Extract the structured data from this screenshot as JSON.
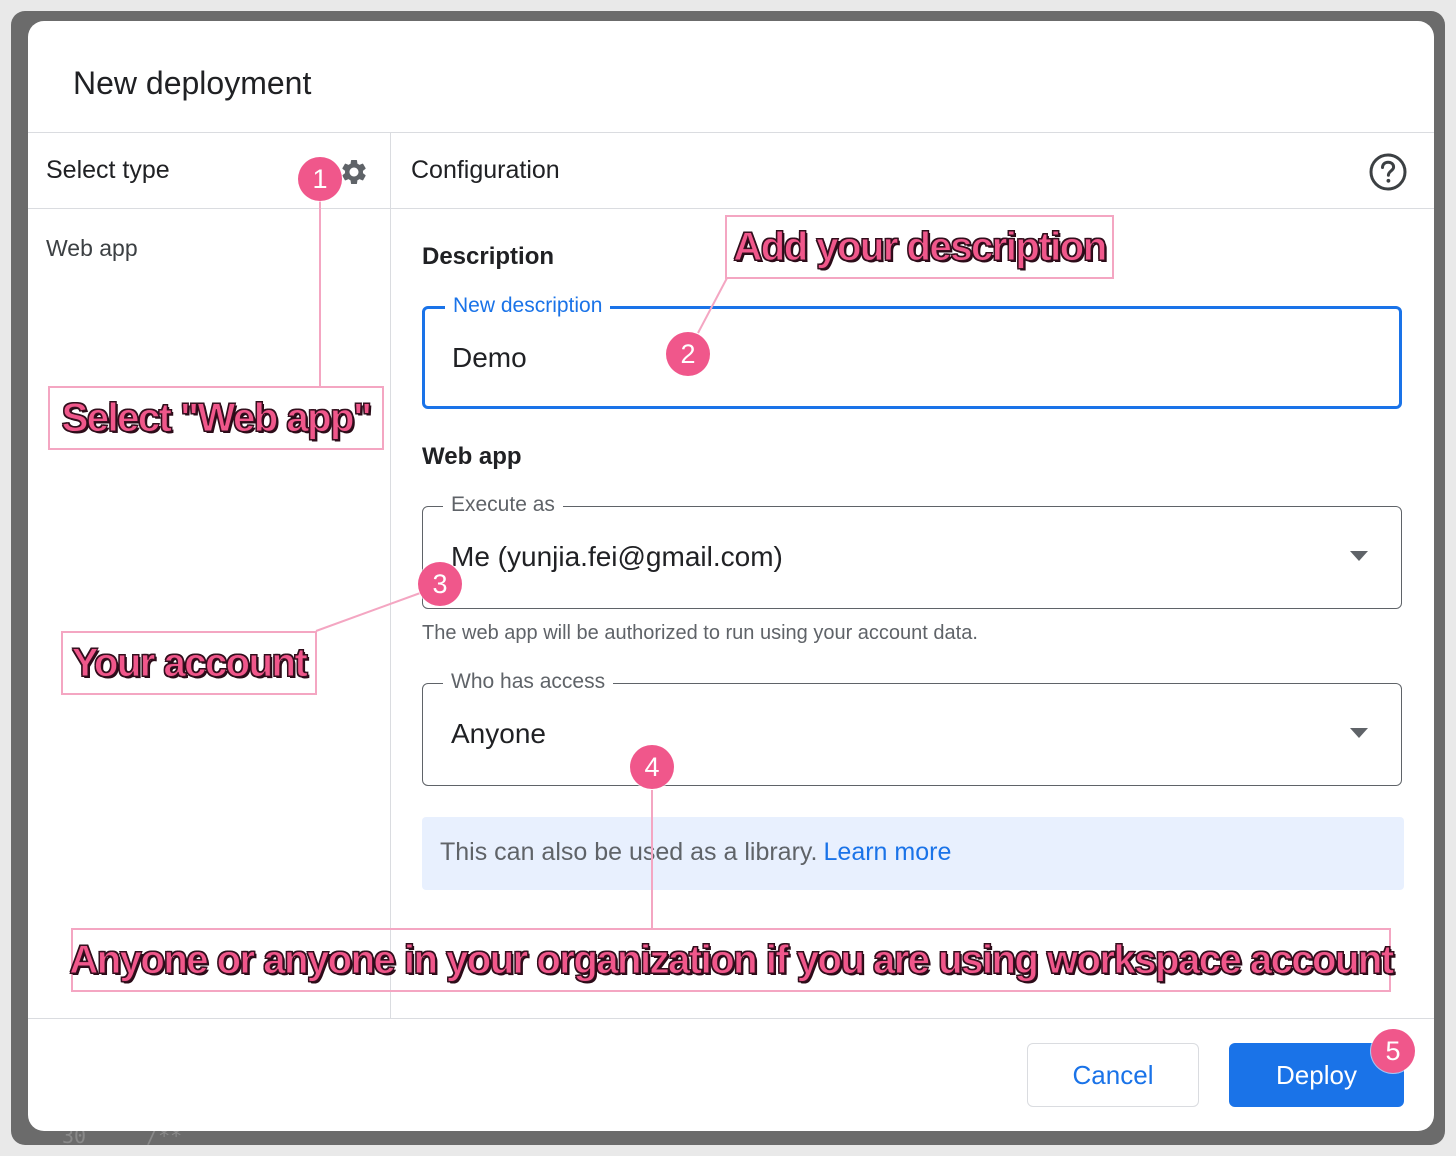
{
  "dialog": {
    "title": "New deployment",
    "sidebar": {
      "header": "Select type",
      "settings_icon": "gear-icon",
      "items": [
        {
          "label": "Web app"
        }
      ]
    },
    "configuration": {
      "header": "Configuration",
      "help_icon": "help-circle-icon",
      "description_section": {
        "heading": "Description",
        "field": {
          "label": "New description",
          "value": "Demo"
        }
      },
      "web_app_section": {
        "heading": "Web app",
        "execute_as": {
          "label": "Execute as",
          "value": "Me (yunjia.fei@gmail.com)"
        },
        "helper_text": "The web app will be authorized to run using your account data.",
        "who_has_access": {
          "label": "Who has access",
          "value": "Anyone"
        }
      },
      "info": {
        "text": "This can also be used as a library.",
        "link": "Learn more"
      }
    },
    "buttons": {
      "cancel": "Cancel",
      "deploy": "Deploy"
    }
  },
  "background_code": {
    "line_number": "30",
    "text": "/**"
  },
  "annotations": {
    "badges": [
      "1",
      "2",
      "3",
      "4",
      "5"
    ],
    "callouts": {
      "select_web_app": "Select \"Web app\"",
      "add_description": "Add your description",
      "your_account": "Your account",
      "anyone": "Anyone or anyone in your organization if you are using workspace account"
    },
    "accent_color": "#f0578b"
  },
  "colors": {
    "primary": "#1a73e8",
    "info_background": "#e8f0fe"
  }
}
